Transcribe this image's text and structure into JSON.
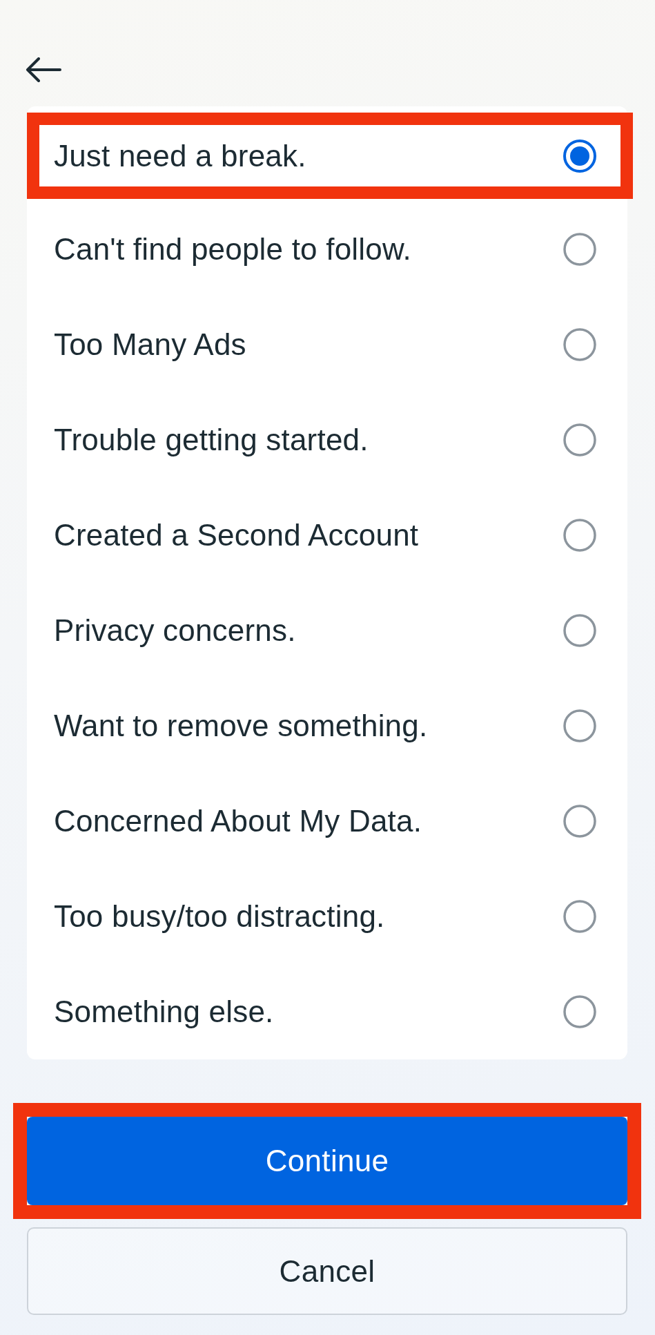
{
  "options": [
    {
      "label": "Just need a break.",
      "selected": true,
      "highlighted": true
    },
    {
      "label": "Can't find people to follow.",
      "selected": false,
      "highlighted": false
    },
    {
      "label": "Too Many Ads",
      "selected": false,
      "highlighted": false
    },
    {
      "label": "Trouble getting started.",
      "selected": false,
      "highlighted": false
    },
    {
      "label": "Created a Second Account",
      "selected": false,
      "highlighted": false
    },
    {
      "label": "Privacy concerns.",
      "selected": false,
      "highlighted": false
    },
    {
      "label": "Want to remove something.",
      "selected": false,
      "highlighted": false
    },
    {
      "label": "Concerned About My Data.",
      "selected": false,
      "highlighted": false
    },
    {
      "label": "Too busy/too distracting.",
      "selected": false,
      "highlighted": false
    },
    {
      "label": "Something else.",
      "selected": false,
      "highlighted": false
    }
  ],
  "buttons": [
    {
      "label": "Continue",
      "kind": "primary",
      "highlighted": true
    },
    {
      "label": "Cancel",
      "kind": "secondary",
      "highlighted": false
    }
  ]
}
